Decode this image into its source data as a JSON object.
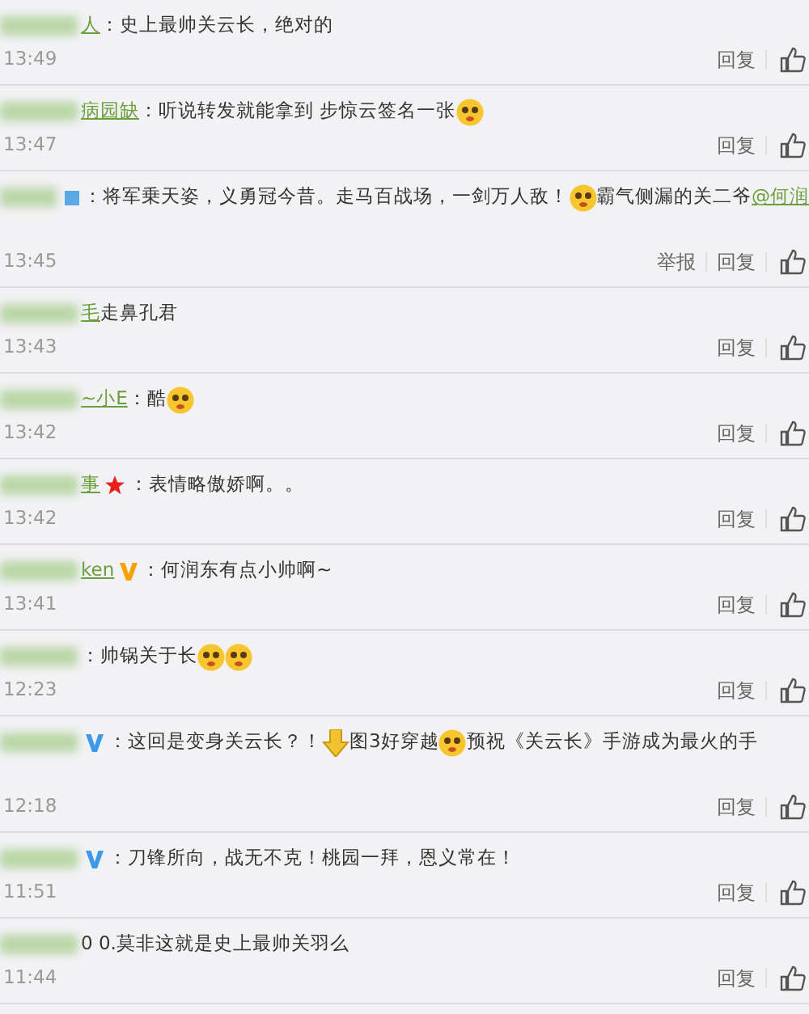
{
  "comments": [
    {
      "user": {
        "name_blurred": true,
        "name": "人"
      },
      "parts": [
        {
          "kind": "text",
          "text": "：史上最帅关云长，绝对的"
        }
      ],
      "time": "13:49",
      "actions": [
        "回复"
      ],
      "tall": false
    },
    {
      "user": {
        "name_blurred": true,
        "name": "病园缺"
      },
      "parts": [
        {
          "kind": "text",
          "text": "：听说转发就能拿到 步惊云签名一张"
        },
        {
          "kind": "emoji"
        }
      ],
      "time": "13:47",
      "actions": [
        "回复"
      ],
      "tall": false
    },
    {
      "user": {
        "name_blurred": true,
        "badge": {
          "kind": "square",
          "color": "#5aa9e6"
        }
      },
      "parts": [
        {
          "kind": "text",
          "text": "：将军乗天姿，义勇冠今昔。走马百战场，一剑万人敌！"
        },
        {
          "kind": "emoji"
        },
        {
          "kind": "text",
          "text": "霸气侧漏的关二爷"
        },
        {
          "kind": "mention",
          "text": "@何润"
        }
      ],
      "time": "13:45",
      "actions": [
        "举报",
        "回复"
      ],
      "tall": true
    },
    {
      "user": {
        "name_blurred": true,
        "name": "毛"
      },
      "parts": [
        {
          "kind": "text",
          "text": "走鼻孔君"
        }
      ],
      "time": "13:43",
      "actions": [
        "回复"
      ],
      "tall": false
    },
    {
      "user": {
        "name_blurred": true,
        "name": "~小E"
      },
      "parts": [
        {
          "kind": "text",
          "text": "：酷"
        },
        {
          "kind": "emoji"
        }
      ],
      "time": "13:42",
      "actions": [
        "回复"
      ],
      "tall": false
    },
    {
      "user": {
        "name_blurred": true,
        "name": "事",
        "badge": {
          "kind": "star",
          "color": "#e8201a"
        }
      },
      "parts": [
        {
          "kind": "text",
          "text": "：表情略傲娇啊。。"
        }
      ],
      "time": "13:42",
      "actions": [
        "回复"
      ],
      "tall": false
    },
    {
      "user": {
        "name_blurred": true,
        "name": "ken",
        "badge": {
          "kind": "verified",
          "color": "#f5a200"
        }
      },
      "parts": [
        {
          "kind": "text",
          "text": "：何润东有点小帅啊~"
        }
      ],
      "time": "13:41",
      "actions": [
        "回复"
      ],
      "tall": false
    },
    {
      "user": {
        "name_blurred": true
      },
      "parts": [
        {
          "kind": "text",
          "text": "：帅锅关于长"
        },
        {
          "kind": "emoji"
        },
        {
          "kind": "emoji"
        }
      ],
      "time": "12:23",
      "actions": [
        "回复"
      ],
      "tall": false
    },
    {
      "user": {
        "name_blurred": true,
        "badge": {
          "kind": "verified",
          "color": "#3d9ae8"
        }
      },
      "parts": [
        {
          "kind": "text",
          "text": "：这回是变身关云长？！"
        },
        {
          "kind": "arrow"
        },
        {
          "kind": "text",
          "text": "图3好穿越"
        },
        {
          "kind": "emoji"
        },
        {
          "kind": "text",
          "text": "预祝《关云长》手游成为最火的手"
        }
      ],
      "time": "12:18",
      "actions": [
        "回复"
      ],
      "tall": true
    },
    {
      "user": {
        "name_blurred": true,
        "badge": {
          "kind": "verified",
          "color": "#3d9ae8"
        }
      },
      "parts": [
        {
          "kind": "text",
          "text": "：刀锋所向，战无不克！桃园一拜，恩义常在！"
        }
      ],
      "time": "11:51",
      "actions": [
        "回复"
      ],
      "tall": false
    },
    {
      "user": {
        "name_blurred": true
      },
      "parts": [
        {
          "kind": "text",
          "text": "0 0.莫非这就是史上最帅关羽么"
        }
      ],
      "time": "11:44",
      "actions": [
        "回复"
      ],
      "tall": false
    }
  ]
}
